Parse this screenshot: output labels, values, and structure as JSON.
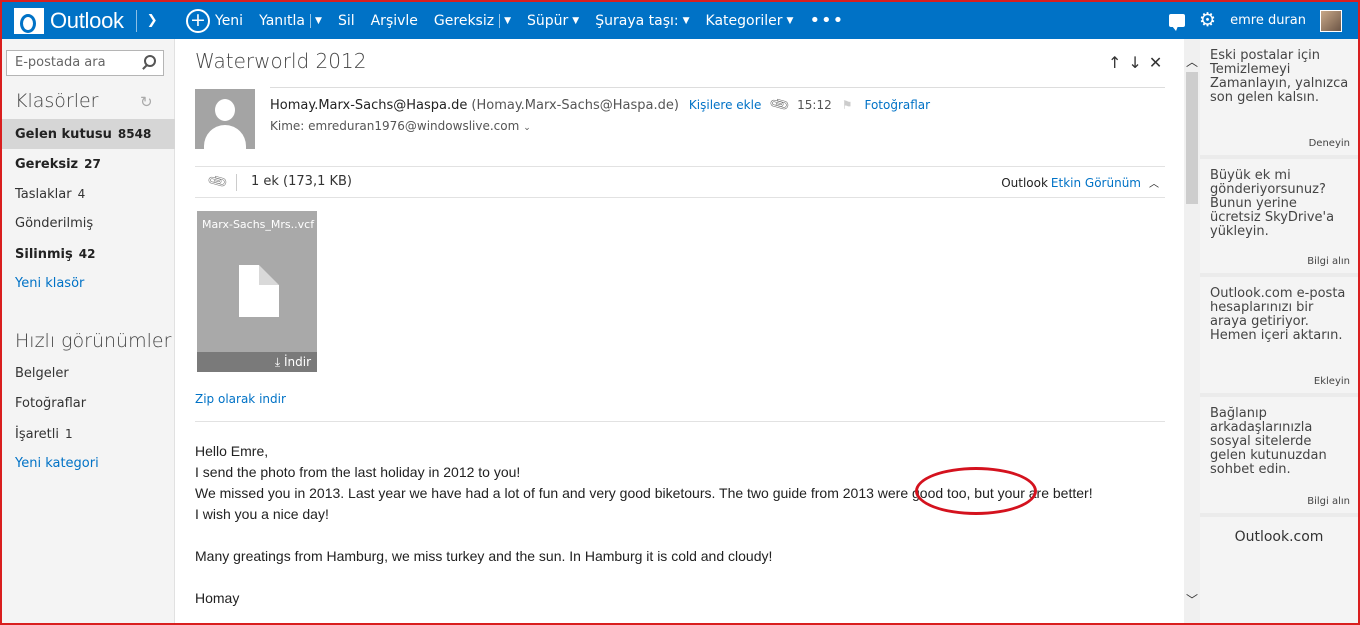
{
  "topbar": {
    "brand": "Outlook",
    "commands": {
      "new": "Yeni",
      "reply": "Yanıtla",
      "delete": "Sil",
      "archive": "Arşivle",
      "junk": "Gereksiz",
      "sweep": "Süpür",
      "move": "Şuraya taşı:",
      "categories": "Kategoriler",
      "more": "•••"
    },
    "user_name": "emre duran"
  },
  "left_nav": {
    "search_placeholder": "E-postada ara",
    "folders_title": "Klasörler",
    "folders": [
      {
        "label": "Gelen kutusu",
        "count": "8548"
      },
      {
        "label": "Gereksiz",
        "count": "27"
      },
      {
        "label": "Taslaklar",
        "count": "4"
      },
      {
        "label": "Gönderilmiş",
        "count": ""
      },
      {
        "label": "Silinmiş",
        "count": "42"
      }
    ],
    "new_folder": "Yeni klasör",
    "quick_views_title": "Hızlı görünümler",
    "quick_views": [
      {
        "label": "Belgeler",
        "count": ""
      },
      {
        "label": "Fotoğraflar",
        "count": ""
      },
      {
        "label": "İşaretli",
        "count": "1"
      }
    ],
    "new_category": "Yeni kategori"
  },
  "message": {
    "subject": "Waterworld 2012",
    "sender_name": "Homay.Marx-Sachs@Haspa.de",
    "sender_address": "(Homay.Marx-Sachs@Haspa.de)",
    "add_contact": "Kişilere ekle",
    "time": "15:12",
    "photos": "Fotoğraflar",
    "to": "Kime: emreduran1976@windowslive.com",
    "attachment_summary": "1 ek (173,1 KB)",
    "active_view_prefix": "Outlook",
    "active_view_link": "Etkin Görünüm",
    "attachment": {
      "name": "Marx-Sachs_Mrs..vcf",
      "download": "İndir"
    },
    "zip_download": "Zip olarak indir",
    "body": [
      "Hello Emre,",
      "I send the photo from the last holiday in 2012 to you!",
      "We missed you  in 2013. Last year we have had a lot of fun and very good biketours. The two guide from 2013 were good too, but your are better!",
      "I wish you a nice day!",
      "",
      "Many greatings from Hamburg, we miss turkey and the sun. In Hamburg it is cold and cloudy!",
      "",
      "Homay"
    ]
  },
  "right_pane": {
    "ads": [
      {
        "text": "Eski postalar için Temizlemeyi Zamanlayın, yalnızca son gelen kalsın.",
        "action": "Deneyin"
      },
      {
        "text": "Büyük ek mi gönderiyorsunuz? Bunun yerine ücretsiz SkyDrive'a yükleyin.",
        "action": "Bilgi alın"
      },
      {
        "text": "Outlook.com e-posta hesaplarınızı bir araya getiriyor. Hemen içeri aktarın.",
        "action": "Ekleyin"
      },
      {
        "text": "Bağlanıp arkadaşlarınızla sosyal sitelerde gelen kutunuzdan sohbet edin.",
        "action": "Bilgi alın"
      }
    ],
    "footer": "Outlook.com"
  },
  "colors": {
    "brand_blue": "#0072c6",
    "annotation_red": "#d4121e"
  }
}
